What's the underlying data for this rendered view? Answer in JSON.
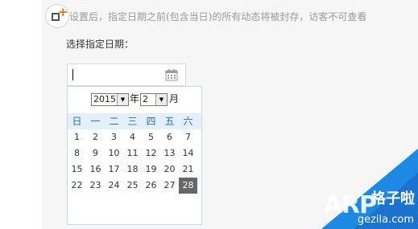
{
  "notice": "设置后，指定日期之前(包含当日)的所有动态将被封存，访客不可查看",
  "select_label": "选择指定日期：",
  "date_input": {
    "value": "",
    "placeholder": ""
  },
  "calendar": {
    "year": "2015",
    "year_unit": "年",
    "month": "2",
    "month_unit": "月",
    "weekdays": [
      "日",
      "一",
      "二",
      "三",
      "四",
      "五",
      "六"
    ],
    "weeks": [
      [
        "1",
        "2",
        "3",
        "4",
        "5",
        "6",
        "7"
      ],
      [
        "8",
        "9",
        "10",
        "11",
        "12",
        "13",
        "14"
      ],
      [
        "15",
        "16",
        "17",
        "18",
        "19",
        "20",
        "21"
      ],
      [
        "22",
        "23",
        "24",
        "25",
        "26",
        "27",
        "28"
      ]
    ],
    "selected_day": "28"
  },
  "watermark": {
    "brand": "ARP",
    "cn": "格子啦",
    "url": "gezila.com"
  },
  "colors": {
    "panel_bg": "#f6f6f6",
    "week_header_bg": "#e3f0fb",
    "selected_day_bg": "#666666",
    "plus_accent": "#ff6a00",
    "watermark_blue": "#1e88e5"
  },
  "icons": [
    "add-post-icon",
    "calendar-icon",
    "dropdown-arrow-icon"
  ]
}
